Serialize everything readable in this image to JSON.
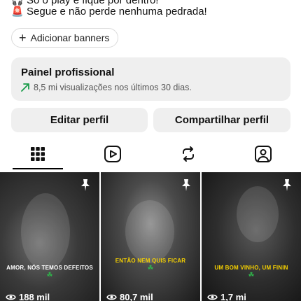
{
  "bio": {
    "line1_icon": "headphones-emoji",
    "line1_text": "Só o play e fique por dentro!",
    "line2_icon": "siren-emoji",
    "line2_text": "Segue e não perde nenhuma pedrada!"
  },
  "banners": {
    "label": "Adicionar banners",
    "icon": "plus-icon"
  },
  "panel": {
    "title": "Painel profissional",
    "subtitle": "8,5 mi visualizações nos últimos 30 dias.",
    "accent": "#1a9c4a"
  },
  "actions": {
    "edit_label": "Editar perfil",
    "share_label": "Compartilhar perfil"
  },
  "tabs": [
    {
      "icon": "grid-icon",
      "active": true
    },
    {
      "icon": "reels-icon",
      "active": false
    },
    {
      "icon": "reposts-icon",
      "active": false
    },
    {
      "icon": "tagged-icon",
      "active": false
    }
  ],
  "posts": [
    {
      "caption": "AMOR, NÓS TEMOS DEFEITOS",
      "caption_color": "#ffffff",
      "views": "188 mil",
      "pinned": true
    },
    {
      "caption": "ENTÃO NEM QUIS FICAR",
      "caption_color": "#f5d000",
      "views": "80,7 mil",
      "pinned": true
    },
    {
      "caption": "UM BOM VINHO, UM FININ",
      "caption_color": "#f5d000",
      "views": "1,7 mi",
      "pinned": true
    }
  ]
}
